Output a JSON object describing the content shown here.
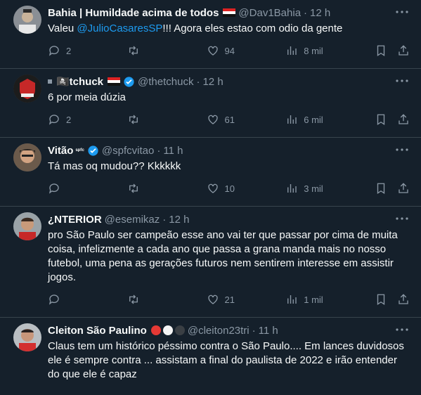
{
  "colors": {
    "background": "#15202b",
    "text": "#f7f9f9",
    "muted": "#8b98a5",
    "link": "#1d9bf0",
    "divider": "#38444d"
  },
  "tweets": [
    {
      "name": "Bahia | Humildade acima de todos",
      "handle": "@Dav1Bahia",
      "time": "12 h",
      "text_before": "Valeu ",
      "mention": "@JulioCasaresSP",
      "text_after": "!!! Agora eles estao com odio da gente",
      "replies": "2",
      "retweets": "",
      "likes": "94",
      "views": "8 mil"
    },
    {
      "name": "🏴‍☠️tchuck",
      "handle": "@thetchuck",
      "time": "12 h",
      "text": "6 por meia dúzia",
      "replies": "2",
      "retweets": "",
      "likes": "61",
      "views": "6 mil"
    },
    {
      "name": "Vitão",
      "name_suffix": "ˢᵖᶠᶜ",
      "handle": "@spfcvitao",
      "time": "11 h",
      "text": "Tá mas oq mudou?? Kkkkkk",
      "replies": "",
      "retweets": "",
      "likes": "10",
      "views": "3 mil"
    },
    {
      "name": "¿NTERIOR",
      "handle": "@esemikaz",
      "time": "12 h",
      "text": "pro São Paulo ser campeão esse ano vai ter que passar por cima de muita coisa, infelizmente a cada ano que passa a grana manda mais no nosso futebol, uma pena as gerações futuros nem sentirem interesse em assistir jogos.",
      "replies": "",
      "retweets": "",
      "likes": "21",
      "views": "1 mil"
    },
    {
      "name": "Cleiton São Paulino",
      "handle": "@cleiton23tri",
      "time": "11 h",
      "text": "Claus tem um histórico péssimo contra o São Paulo.... Em lances duvidosos ele é sempre contra ... assistam a final do paulista de 2022 e irão entender do que ele é capaz"
    }
  ]
}
